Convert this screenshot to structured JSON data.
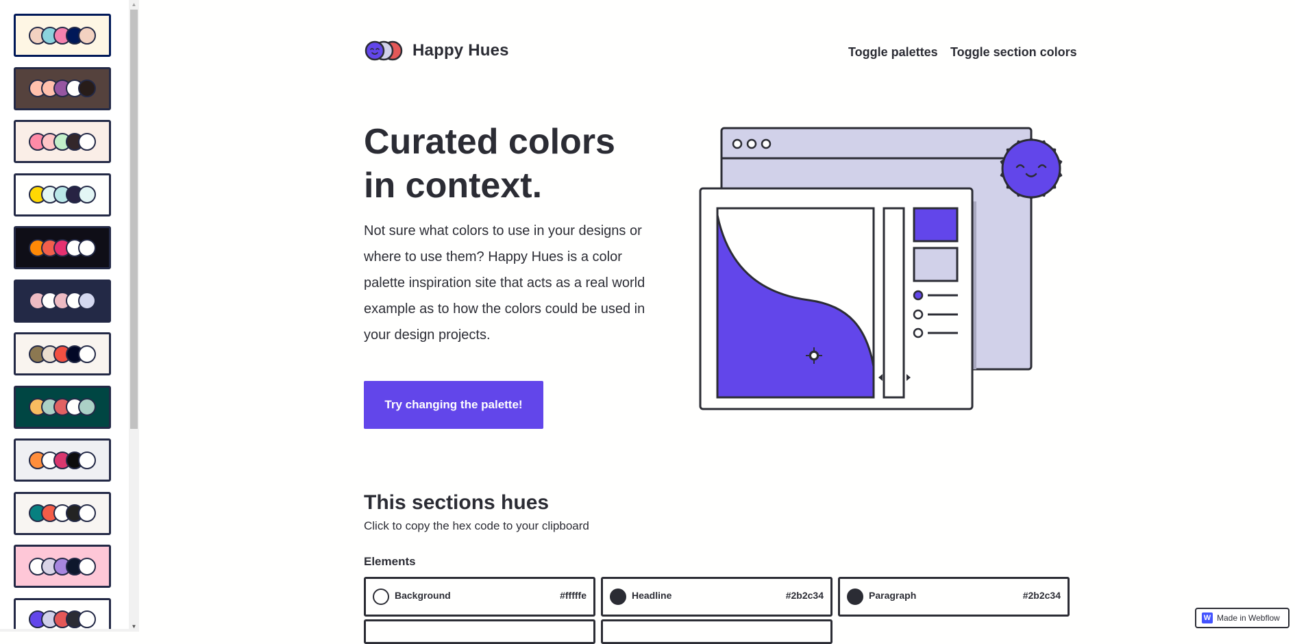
{
  "sidebar": {
    "palettes": [
      {
        "bg": "#fef6e4",
        "dots": [
          "#f3d2c1",
          "#8bd3dd",
          "#f582ae",
          "#001858",
          "#f3d2c1"
        ]
      },
      {
        "bg": "#55423d",
        "dots": [
          "#ffc0ad",
          "#ffc0ad",
          "#9656a1",
          "#fffffe",
          "#271c19"
        ]
      },
      {
        "bg": "#faeee7",
        "dots": [
          "#ff8ba7",
          "#ffc6c7",
          "#c3f0ca",
          "#33272a",
          "#fffffe"
        ]
      },
      {
        "bg": "#fffffe",
        "dots": [
          "#ffd803",
          "#e3f6f5",
          "#bae8e8",
          "#272343",
          "#e3f6f5"
        ]
      },
      {
        "bg": "#0f0e17",
        "dots": [
          "#ff8906",
          "#f25f4c",
          "#e53170",
          "#fffffe",
          "#fffffe"
        ]
      },
      {
        "bg": "#232946",
        "dots": [
          "#eebbc3",
          "#fffffe",
          "#eebbc3",
          "#fffffe",
          "#d4d8f0"
        ]
      },
      {
        "bg": "#f9f4ef",
        "dots": [
          "#8c7851",
          "#eaddcf",
          "#f25042",
          "#020826",
          "#fffffe"
        ]
      },
      {
        "bg": "#004643",
        "dots": [
          "#f9bc60",
          "#abd1c6",
          "#e16162",
          "#fffffe",
          "#abd1c6"
        ]
      },
      {
        "bg": "#eff0f3",
        "dots": [
          "#ff8e3c",
          "#fffffe",
          "#d9376e",
          "#0d0d0d",
          "#fffffe"
        ]
      },
      {
        "bg": "#f8f5f2",
        "dots": [
          "#078080",
          "#f45d48",
          "#fffffe",
          "#232323",
          "#fffffe"
        ]
      },
      {
        "bg": "#fec7d7",
        "dots": [
          "#fffffe",
          "#d9d4e7",
          "#a786df",
          "#0e172c",
          "#fffffe"
        ]
      },
      {
        "bg": "#fffffe",
        "dots": [
          "#6246ea",
          "#d1d1e9",
          "#e45858",
          "#2b2c34",
          "#fffffe"
        ]
      }
    ]
  },
  "header": {
    "brand": "Happy Hues",
    "nav": [
      "Toggle palettes",
      "Toggle section colors"
    ]
  },
  "hero": {
    "title": "Curated colors in context.",
    "text": "Not sure what colors to use in your designs or where to use them? Happy Hues is a color palette inspiration site that acts as a real world example as to how the colors could be used in your design projects.",
    "cta": "Try changing the palette!"
  },
  "section": {
    "title": "This sections hues",
    "subtitle": "Click to copy the hex code to your clipboard",
    "elements_label": "Elements",
    "hues": [
      {
        "name": "Background",
        "hex": "#fffffe",
        "color": "#fffffe"
      },
      {
        "name": "Headline",
        "hex": "#2b2c34",
        "color": "#2b2c34"
      },
      {
        "name": "Paragraph",
        "hex": "#2b2c34",
        "color": "#2b2c34"
      }
    ]
  },
  "badge": {
    "icon": "W",
    "text": "Made in Webflow"
  },
  "colors": {
    "accent": "#6246ea",
    "secondary": "#d1d1e9",
    "tertiary": "#e45858",
    "stroke": "#2b2c34"
  }
}
